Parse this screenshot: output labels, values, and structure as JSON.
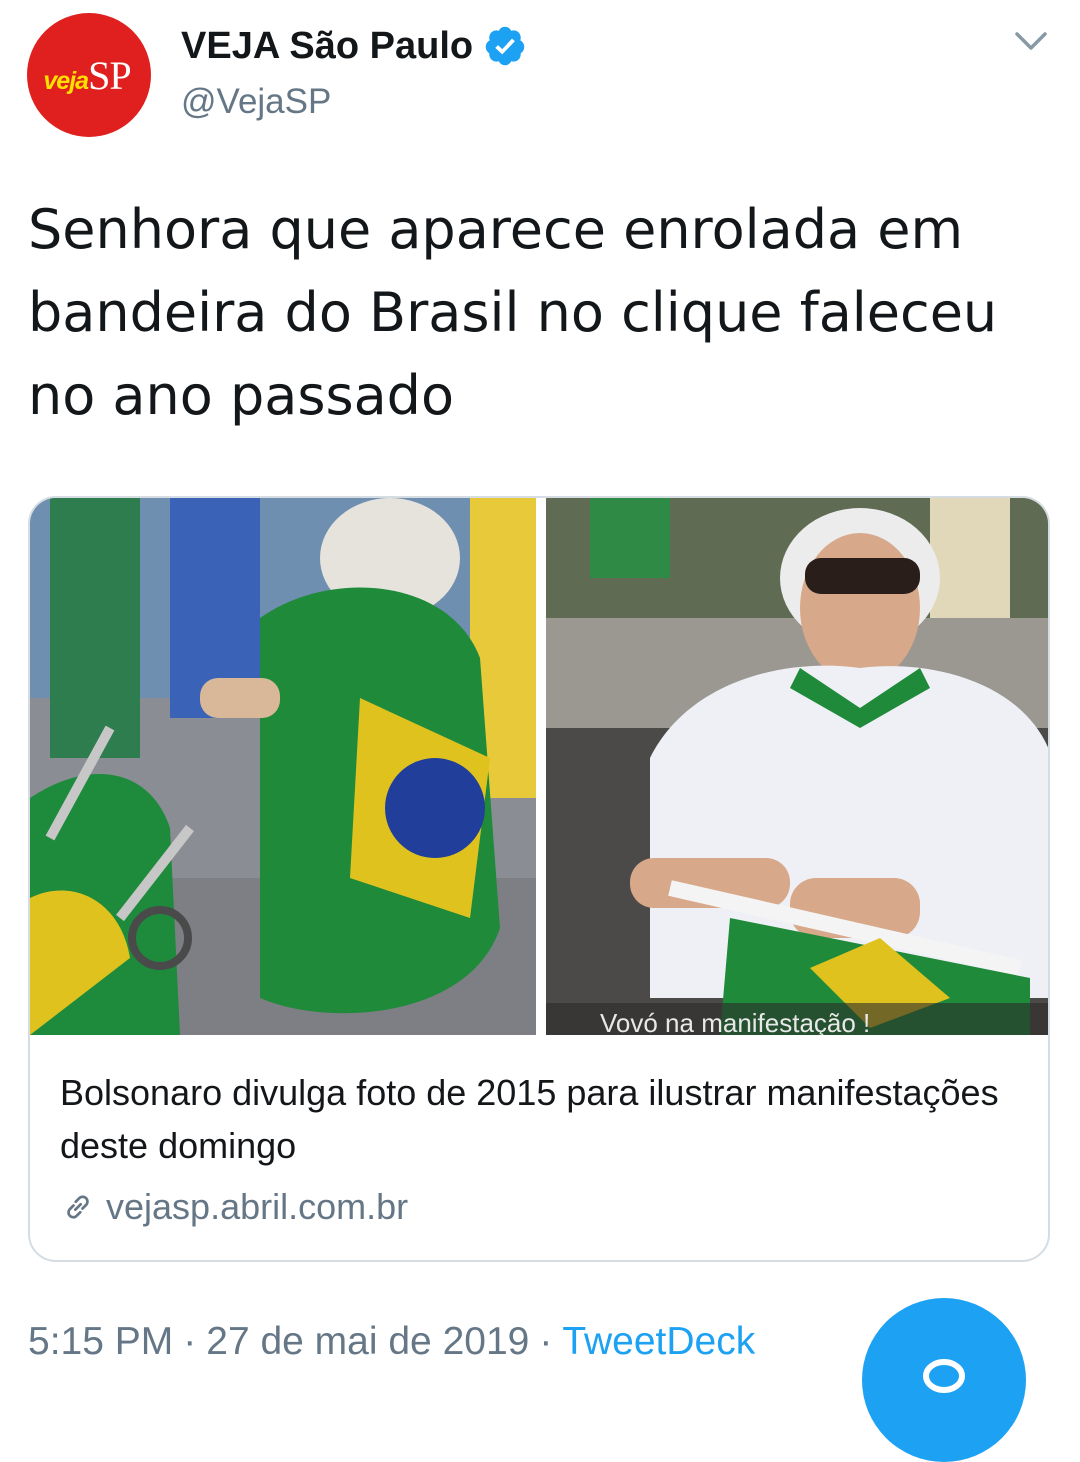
{
  "user": {
    "display_name": "VEJA São Paulo",
    "handle": "@VejaSP",
    "verified": true,
    "avatar_brand_a": "veja",
    "avatar_brand_b": "SP"
  },
  "tweet": {
    "text": "Senhora que aparece enrolada em bandeira do Brasil no clique faleceu no ano passado"
  },
  "card": {
    "title": "Bolsonaro divulga foto de 2015 para ilustrar manifestações deste domingo",
    "domain": "vejasp.abril.com.br",
    "image_caption": "Vovó na manifestação !"
  },
  "meta": {
    "time": "5:15 PM",
    "separator": "·",
    "date": "27 de mai de 2019",
    "source": "TweetDeck"
  },
  "icons": {
    "verified": "verified-badge-icon",
    "menu": "chevron-down-icon",
    "link": "link-icon",
    "compose": "reply-bubble-icon"
  },
  "colors": {
    "accent": "#1da1f2",
    "secondary_text": "#657786",
    "avatar_bg": "#e0201f",
    "border": "#d5dde3"
  }
}
